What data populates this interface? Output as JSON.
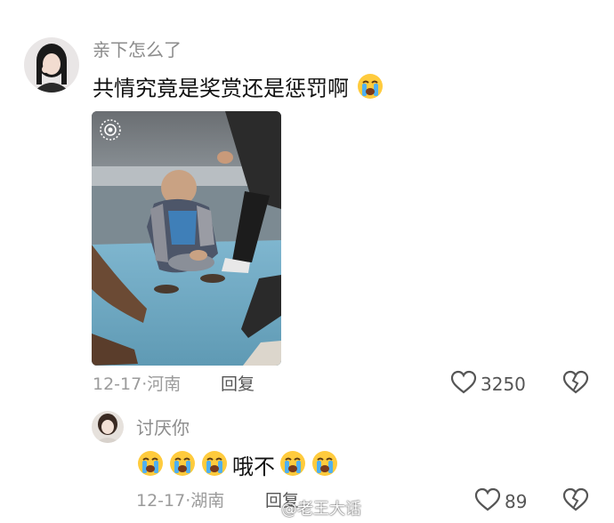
{
  "comments": [
    {
      "username": "亲下怎么了",
      "text": "共情究竟是奖赏还是惩罚啊",
      "emoji": "loudly-crying-face",
      "date": "12-17",
      "location": "河南",
      "reply_label": "回复",
      "likes": "3250"
    },
    {
      "username": "讨厌你",
      "text": "哦不",
      "emoji": "loudly-crying-face",
      "date": "12-17",
      "location": "湖南",
      "reply_label": "回复",
      "likes": "89"
    }
  ],
  "separator": "·",
  "watermark": "@老王大话",
  "colors": {
    "username": "#8c8c8c",
    "text": "#111111",
    "meta": "#9b9b9b",
    "icon": "#555555"
  }
}
